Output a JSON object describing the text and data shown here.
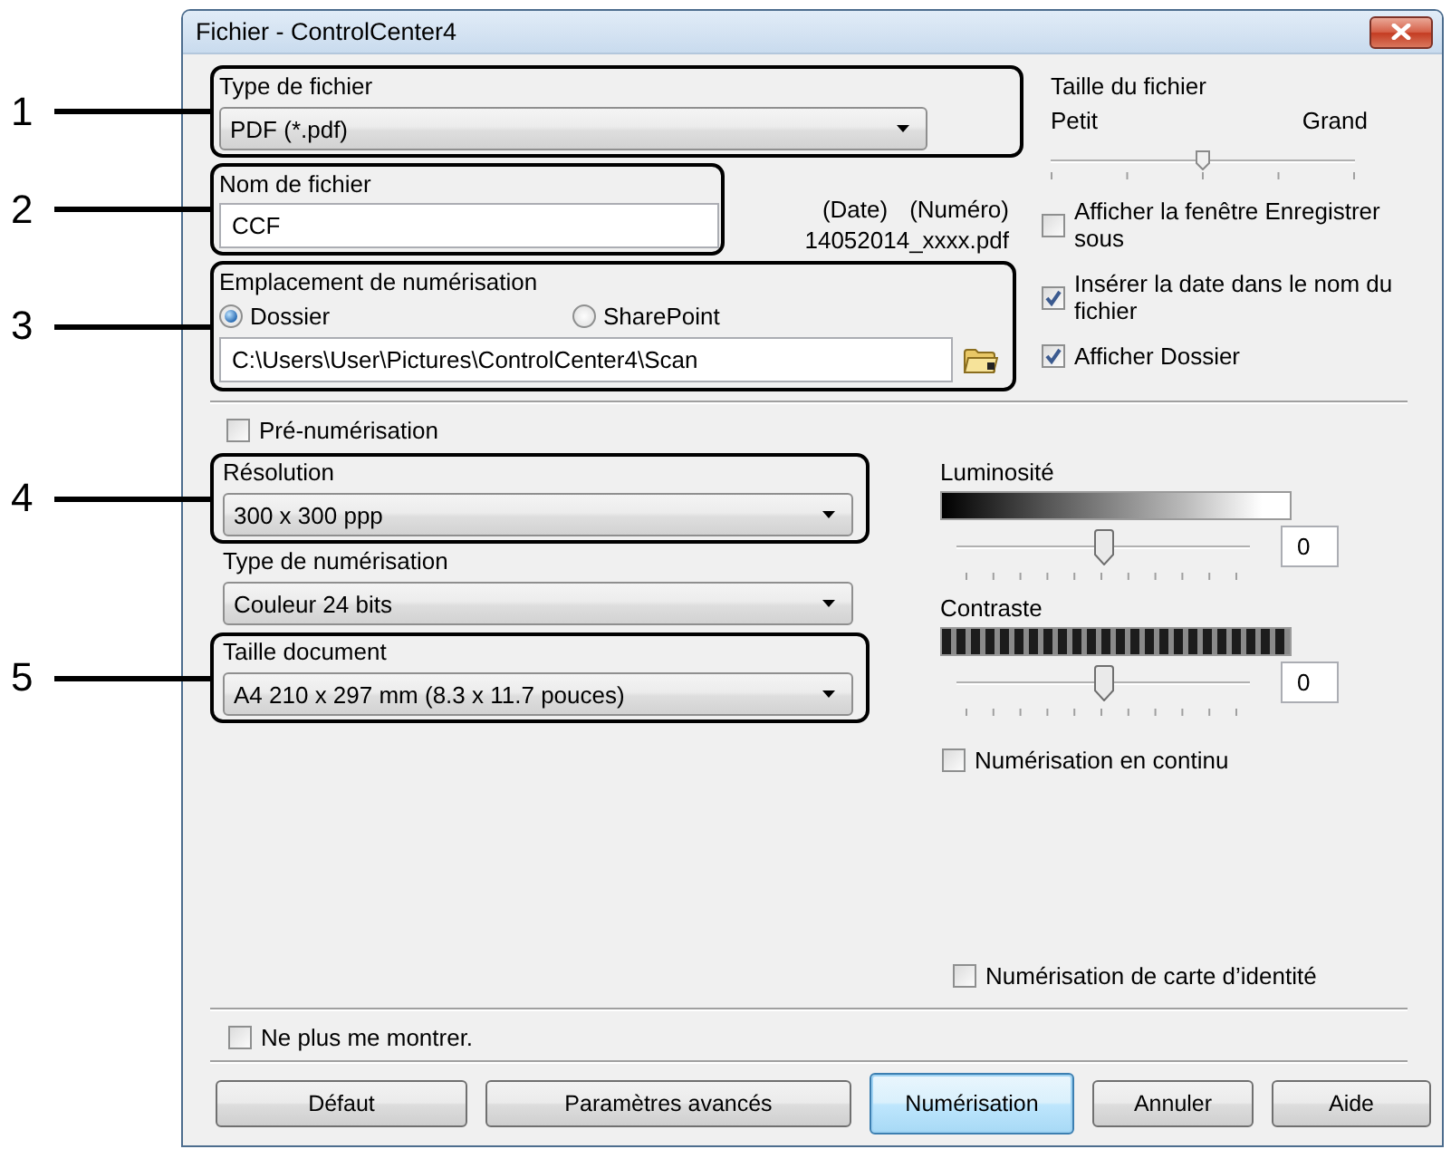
{
  "window": {
    "title": "Fichier - ControlCenter4"
  },
  "file_type": {
    "label": "Type de fichier",
    "value": "PDF (*.pdf)",
    "callout": "1"
  },
  "file_name": {
    "label": "Nom de fichier",
    "value": "CCF",
    "callout": "2"
  },
  "name_pattern": {
    "date_label": "(Date)",
    "number_label": "(Numéro)",
    "example": "14052014_xxxx.pdf"
  },
  "scan_location": {
    "label": "Emplacement de numérisation",
    "callout": "3",
    "options": [
      {
        "label": "Dossier",
        "selected": true
      },
      {
        "label": "SharePoint",
        "selected": false
      }
    ],
    "path": "C:\\Users\\User\\Pictures\\ControlCenter4\\Scan"
  },
  "file_size": {
    "label": "Taille du fichier",
    "min_label": "Petit",
    "max_label": "Grand",
    "level": 0.5
  },
  "options": [
    {
      "label": "Afficher la fenêtre Enregistrer sous",
      "checked": false
    },
    {
      "label": "Insérer la date dans le nom du fichier",
      "checked": true
    },
    {
      "label": "Afficher Dossier",
      "checked": true
    }
  ],
  "prescan": {
    "label": "Pré-numérisation",
    "checked": false
  },
  "resolution": {
    "label": "Résolution",
    "value": "300 x 300 ppp",
    "callout": "4"
  },
  "scan_type": {
    "label": "Type de numérisation",
    "value": "Couleur 24 bits"
  },
  "document_size": {
    "label": "Taille document",
    "value": "A4 210 x 297 mm (8.3 x 11.7 pouces)",
    "callout": "5"
  },
  "adjustments": [
    {
      "kind": "gradient",
      "label": "Luminosité",
      "level": 0.5,
      "reading": "0"
    },
    {
      "kind": "stripes",
      "label": "Contraste",
      "level": 0.5,
      "reading": "0"
    }
  ],
  "continuous_scan": {
    "label": "Numérisation en continu",
    "checked": false
  },
  "id_card_scan": {
    "label": "Numérisation de carte d’identité",
    "checked": false
  },
  "dont_show_again": {
    "label": "Ne plus me montrer.",
    "checked": false
  },
  "buttons": [
    {
      "label": "Défaut",
      "default": false
    },
    {
      "label": "Paramètres avancés",
      "default": false
    },
    {
      "label": "Numérisation",
      "default": true
    },
    {
      "label": "Annuler",
      "default": false
    },
    {
      "label": "Aide",
      "default": false
    }
  ]
}
